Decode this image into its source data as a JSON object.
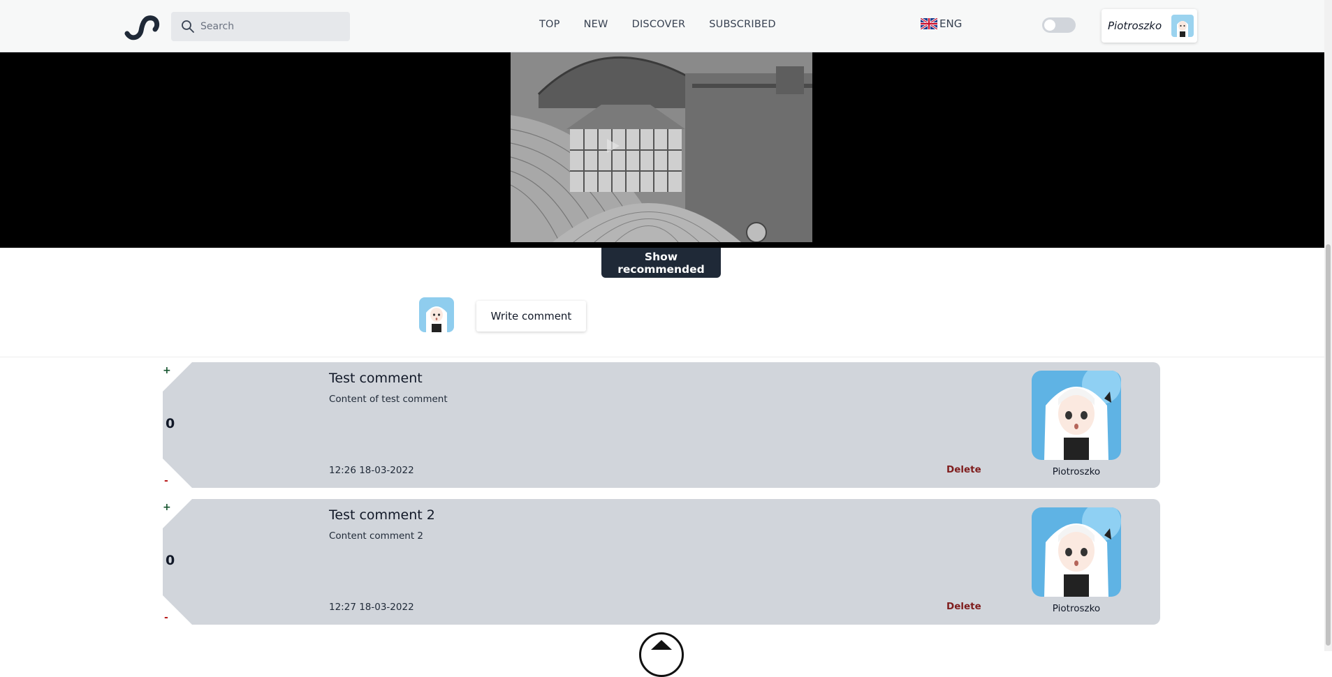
{
  "header": {
    "search_placeholder": "Search",
    "nav": [
      "TOP",
      "NEW",
      "DISCOVER",
      "SUBSCRIBED"
    ],
    "language": "ENG",
    "username": "Piotroszko",
    "theme_toggle_on": false
  },
  "video": {
    "show_recommended_label": "Show recommended"
  },
  "compose": {
    "write_comment_label": "Write comment"
  },
  "comments": [
    {
      "title": "Test comment",
      "content": "Content of test comment",
      "time": "12:26 18-03-2022",
      "score": "0",
      "plus": "+",
      "minus": "-",
      "delete_label": "Delete",
      "author": "Piotroszko"
    },
    {
      "title": "Test comment 2",
      "content": "Content comment 2",
      "time": "12:27 18-03-2022",
      "score": "0",
      "plus": "+",
      "minus": "-",
      "delete_label": "Delete",
      "author": "Piotroszko"
    }
  ],
  "colors": {
    "header_bg": "#f7f8f8",
    "accent_dark": "#1f2937",
    "comment_bg": "#d1d5db",
    "delete": "#7f1d1d",
    "vote_up": "#14532d",
    "vote_down": "#b91c1c"
  },
  "icons": {
    "logo": "wave-logo-icon",
    "search": "search-icon",
    "flag": "uk-flag-icon",
    "scroll_top": "arrow-up-icon"
  }
}
